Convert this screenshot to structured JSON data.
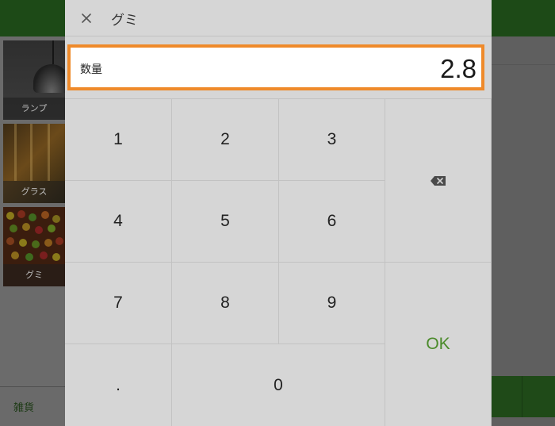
{
  "background": {
    "tiles": [
      {
        "label": "ランプ"
      },
      {
        "label": "グラス"
      },
      {
        "label": "グミ"
      }
    ],
    "bottom_label": "雑貨"
  },
  "dialog": {
    "title": "グミ",
    "close_icon": "close-icon",
    "quantity": {
      "label": "数量",
      "value": "2.8"
    },
    "keypad": {
      "k1": "1",
      "k2": "2",
      "k3": "3",
      "k4": "4",
      "k5": "5",
      "k6": "6",
      "k7": "7",
      "k8": "8",
      "k9": "9",
      "dot": ".",
      "k0": "0",
      "backspace_icon": "backspace-icon",
      "ok": "OK"
    },
    "colors": {
      "accent_border": "#ef8a2a",
      "ok_text": "#4a8a2a",
      "brand_green": "#1d4a17"
    }
  }
}
